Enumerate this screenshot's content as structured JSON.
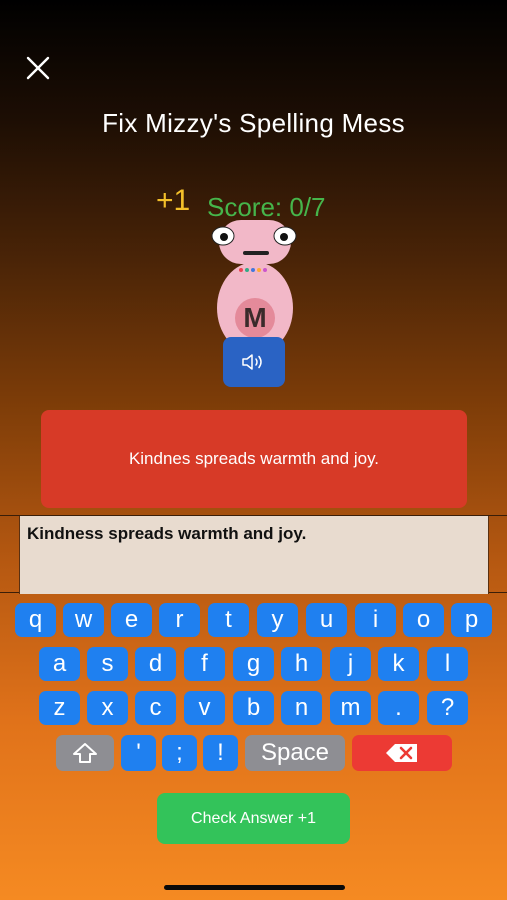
{
  "header": {
    "title": "Fix Mizzy's Spelling Mess"
  },
  "status": {
    "points_flash": "+1",
    "score": "Score: 0/7"
  },
  "mascot": {
    "badge_letter": "M"
  },
  "question": {
    "misspelled_sentence": "Kindnes spreads warmth and joy."
  },
  "answer": {
    "value": "Kindness spreads warmth and joy."
  },
  "keyboard": {
    "row1": [
      "q",
      "w",
      "e",
      "r",
      "t",
      "y",
      "u",
      "i",
      "o",
      "p"
    ],
    "row2": [
      "a",
      "s",
      "d",
      "f",
      "g",
      "h",
      "j",
      "k",
      "l"
    ],
    "row3": [
      "z",
      "x",
      "c",
      "v",
      "b",
      "n",
      "m",
      ".",
      "?"
    ],
    "apostrophe": "'",
    "semicolon": ";",
    "exclamation": "!",
    "space": "Space",
    "shift_icon": "shift-arrow-icon",
    "backspace_icon": "backspace-icon"
  },
  "actions": {
    "check_answer": "Check Answer +1"
  },
  "colors": {
    "key_blue": "#1f80f0",
    "key_gray": "#8e8e93",
    "key_red": "#ec3a34",
    "card_red": "#d73a27",
    "check_green": "#33c35a",
    "plus_yellow": "#f4c02a",
    "score_green": "#46b54b"
  }
}
